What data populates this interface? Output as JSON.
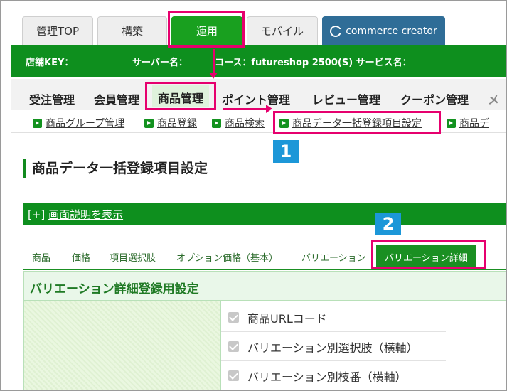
{
  "top_tabs": [
    {
      "label": "管理TOP"
    },
    {
      "label": "構築"
    },
    {
      "label": "運用"
    },
    {
      "label": "モバイル"
    },
    {
      "label": "commerce creator"
    }
  ],
  "infobar": {
    "store_key": "店舗KEY：",
    "server": "サーバー名：",
    "course": "コース：futureshop 2500(S) サービス名："
  },
  "main_menu": [
    {
      "label": "受注管理"
    },
    {
      "label": "会員管理"
    },
    {
      "label": "商品管理"
    },
    {
      "label": "ポイント管理"
    },
    {
      "label": "レビュー管理"
    },
    {
      "label": "クーポン管理"
    },
    {
      "label": "メ"
    }
  ],
  "sub_menu": [
    {
      "label": "商品グループ管理"
    },
    {
      "label": "商品登録"
    },
    {
      "label": "商品検索"
    },
    {
      "label": "商品データ一括登録項目設定"
    },
    {
      "label": "商品デ"
    }
  ],
  "page": {
    "title": "商品データ一括登録項目設定",
    "desc_prefix": "[+]",
    "desc_link": "画面説明を表示"
  },
  "section_tabs": [
    {
      "label": "商品"
    },
    {
      "label": "価格"
    },
    {
      "label": "項目選択肢"
    },
    {
      "label": "オプション価格（基本）"
    },
    {
      "label": "バリエーション"
    },
    {
      "label": "バリエーション詳細"
    }
  ],
  "panel": {
    "title": "バリエーション詳細登録用設定",
    "items": [
      {
        "label": "商品URLコード"
      },
      {
        "label": "バリエーション別選択肢（横軸）"
      },
      {
        "label": "バリエーション別枝番（横軸）"
      }
    ]
  },
  "badges": {
    "one": "1",
    "two": "2"
  },
  "colors": {
    "brand_green": "#0e8f1e",
    "highlight": "#e6006e",
    "badge_blue": "#1c97d8",
    "cc_blue": "#2f6d97"
  }
}
